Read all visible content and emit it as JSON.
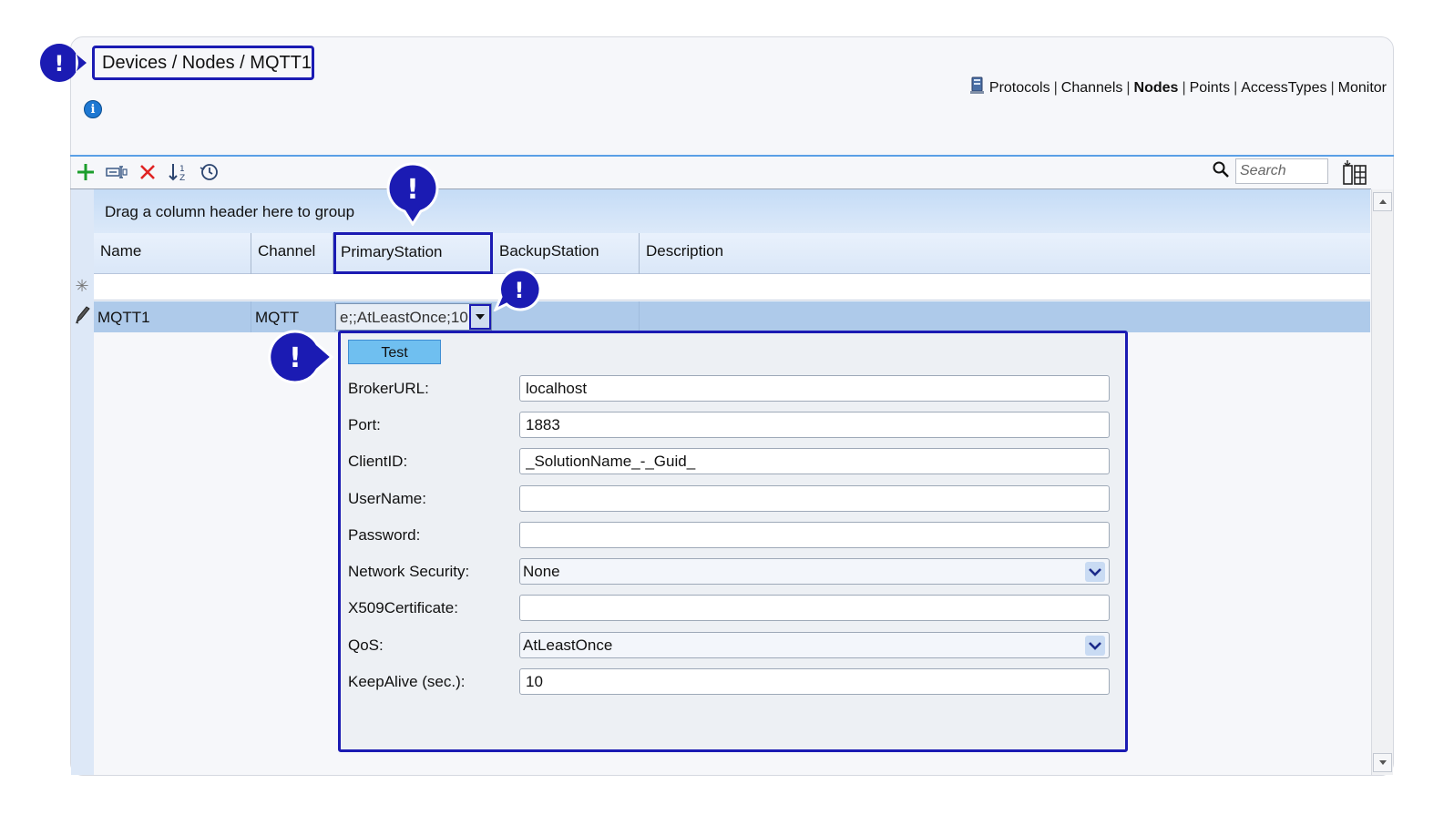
{
  "breadcrumb": "Devices / Nodes / MQTT1",
  "topnav": {
    "items": [
      {
        "label": "Protocols",
        "active": false
      },
      {
        "label": "Channels",
        "active": false
      },
      {
        "label": "Nodes",
        "active": true
      },
      {
        "label": "Points",
        "active": false
      },
      {
        "label": "AccessTypes",
        "active": false
      },
      {
        "label": "Monitor",
        "active": false
      }
    ],
    "separator": "|"
  },
  "toolbar": {
    "icons": [
      "add-icon",
      "rename-icon",
      "delete-icon",
      "sort-icon",
      "history-icon"
    ]
  },
  "search": {
    "placeholder": "Search"
  },
  "grid": {
    "group_hint": "Drag a column header here to group",
    "columns": [
      "Name",
      "Channel",
      "PrimaryStation",
      "BackupStation",
      "Description"
    ],
    "new_row_marker": "✳",
    "row": {
      "name": "MQTT1",
      "channel": "MQTT",
      "primary_station": "e;;AtLeastOnce;10",
      "backup_station": "",
      "description": ""
    }
  },
  "popup": {
    "test_label": "Test",
    "fields": {
      "broker_url": {
        "label": "BrokerURL:",
        "value": "localhost"
      },
      "port": {
        "label": "Port:",
        "value": "1883"
      },
      "client_id": {
        "label": "ClientID:",
        "value": "_SolutionName_-_Guid_"
      },
      "username": {
        "label": "UserName:",
        "value": ""
      },
      "password": {
        "label": "Password:",
        "value": ""
      },
      "network_security": {
        "label": "Network Security:",
        "value": "None"
      },
      "x509": {
        "label": "X509Certificate:",
        "value": ""
      },
      "qos": {
        "label": "QoS:",
        "value": "AtLeastOnce"
      },
      "keepalive": {
        "label": "KeepAlive (sec.):",
        "value": "10"
      }
    }
  },
  "callouts": {
    "glyph": "!"
  },
  "colors": {
    "callout": "#1b1bb3",
    "row_selected": "#aecaea",
    "accent_line": "#5aa0e6",
    "add_green": "#1c9e2c",
    "delete_red": "#e02424"
  }
}
